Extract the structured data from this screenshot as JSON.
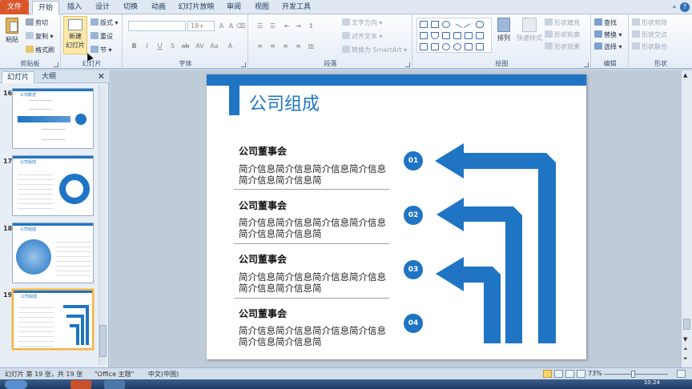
{
  "ribbon_tabs": [
    "文件",
    "开始",
    "插入",
    "设计",
    "切换",
    "动画",
    "幻灯片放映",
    "审阅",
    "视图",
    "开发工具"
  ],
  "active_tab": "开始",
  "ribbon": {
    "clipboard": {
      "paste": "粘贴",
      "cut": "剪切",
      "copy": "复制",
      "format_painter": "格式刷",
      "label": "剪贴板"
    },
    "slides": {
      "new_slide_line1": "新建",
      "new_slide_line2": "幻灯片",
      "layout": "版式",
      "reset": "重设",
      "section": "节",
      "label": "幻灯片"
    },
    "font": {
      "font_size": "18+",
      "label": "字体"
    },
    "paragraph": {
      "text_direction": "文字方向",
      "align_text": "对齐文本",
      "convert_smartart": "转换为 SmartArt",
      "label": "段落"
    },
    "drawing": {
      "arrange": "排列",
      "quick_styles": "快速样式",
      "shape_fill": "形状填充",
      "shape_outline": "形状轮廓",
      "shape_effects": "形状效果",
      "label": "绘图"
    },
    "editing": {
      "find": "查找",
      "replace": "替换",
      "select": "选择",
      "label": "编辑"
    },
    "shapes": {
      "merge_shapes": "形状剪除",
      "shape_intersect": "形状交点",
      "shape_union": "形状联合",
      "label": "形状"
    }
  },
  "panel": {
    "tabs": [
      "幻灯片",
      "大纲"
    ],
    "thumbnails": [
      {
        "number": "16",
        "title": "公司概述"
      },
      {
        "number": "17",
        "title": "公司组成"
      },
      {
        "number": "18",
        "title": "公司组成"
      },
      {
        "number": "19",
        "title": "公司组成"
      }
    ]
  },
  "slide": {
    "title": "公司组成",
    "items": [
      {
        "heading": "公司董事会",
        "body": "简介信息简介信息简介信息简介信息简介信息简介信息简",
        "number": "01"
      },
      {
        "heading": "公司董事会",
        "body": "简介信息简介信息简介信息简介信息简介信息简介信息简",
        "number": "02"
      },
      {
        "heading": "公司董事会",
        "body": "简介信息简介信息简介信息简介信息简介信息简介信息简",
        "number": "03"
      },
      {
        "heading": "公司董事会",
        "body": "简介信息简介信息简介信息简介信息简介信息简介信息简",
        "number": "04"
      }
    ]
  },
  "status": {
    "slide_info": "幻灯片 第 19 张，共 19 张",
    "theme": "\"Office 主题\"",
    "language": "中文(中国)",
    "zoom": "73%"
  },
  "taskbar": {
    "time": "10:24"
  },
  "colors": {
    "accent": "#1f74c4",
    "file_tab": "#d9572b",
    "selected_thumb": "#f0b34a"
  }
}
